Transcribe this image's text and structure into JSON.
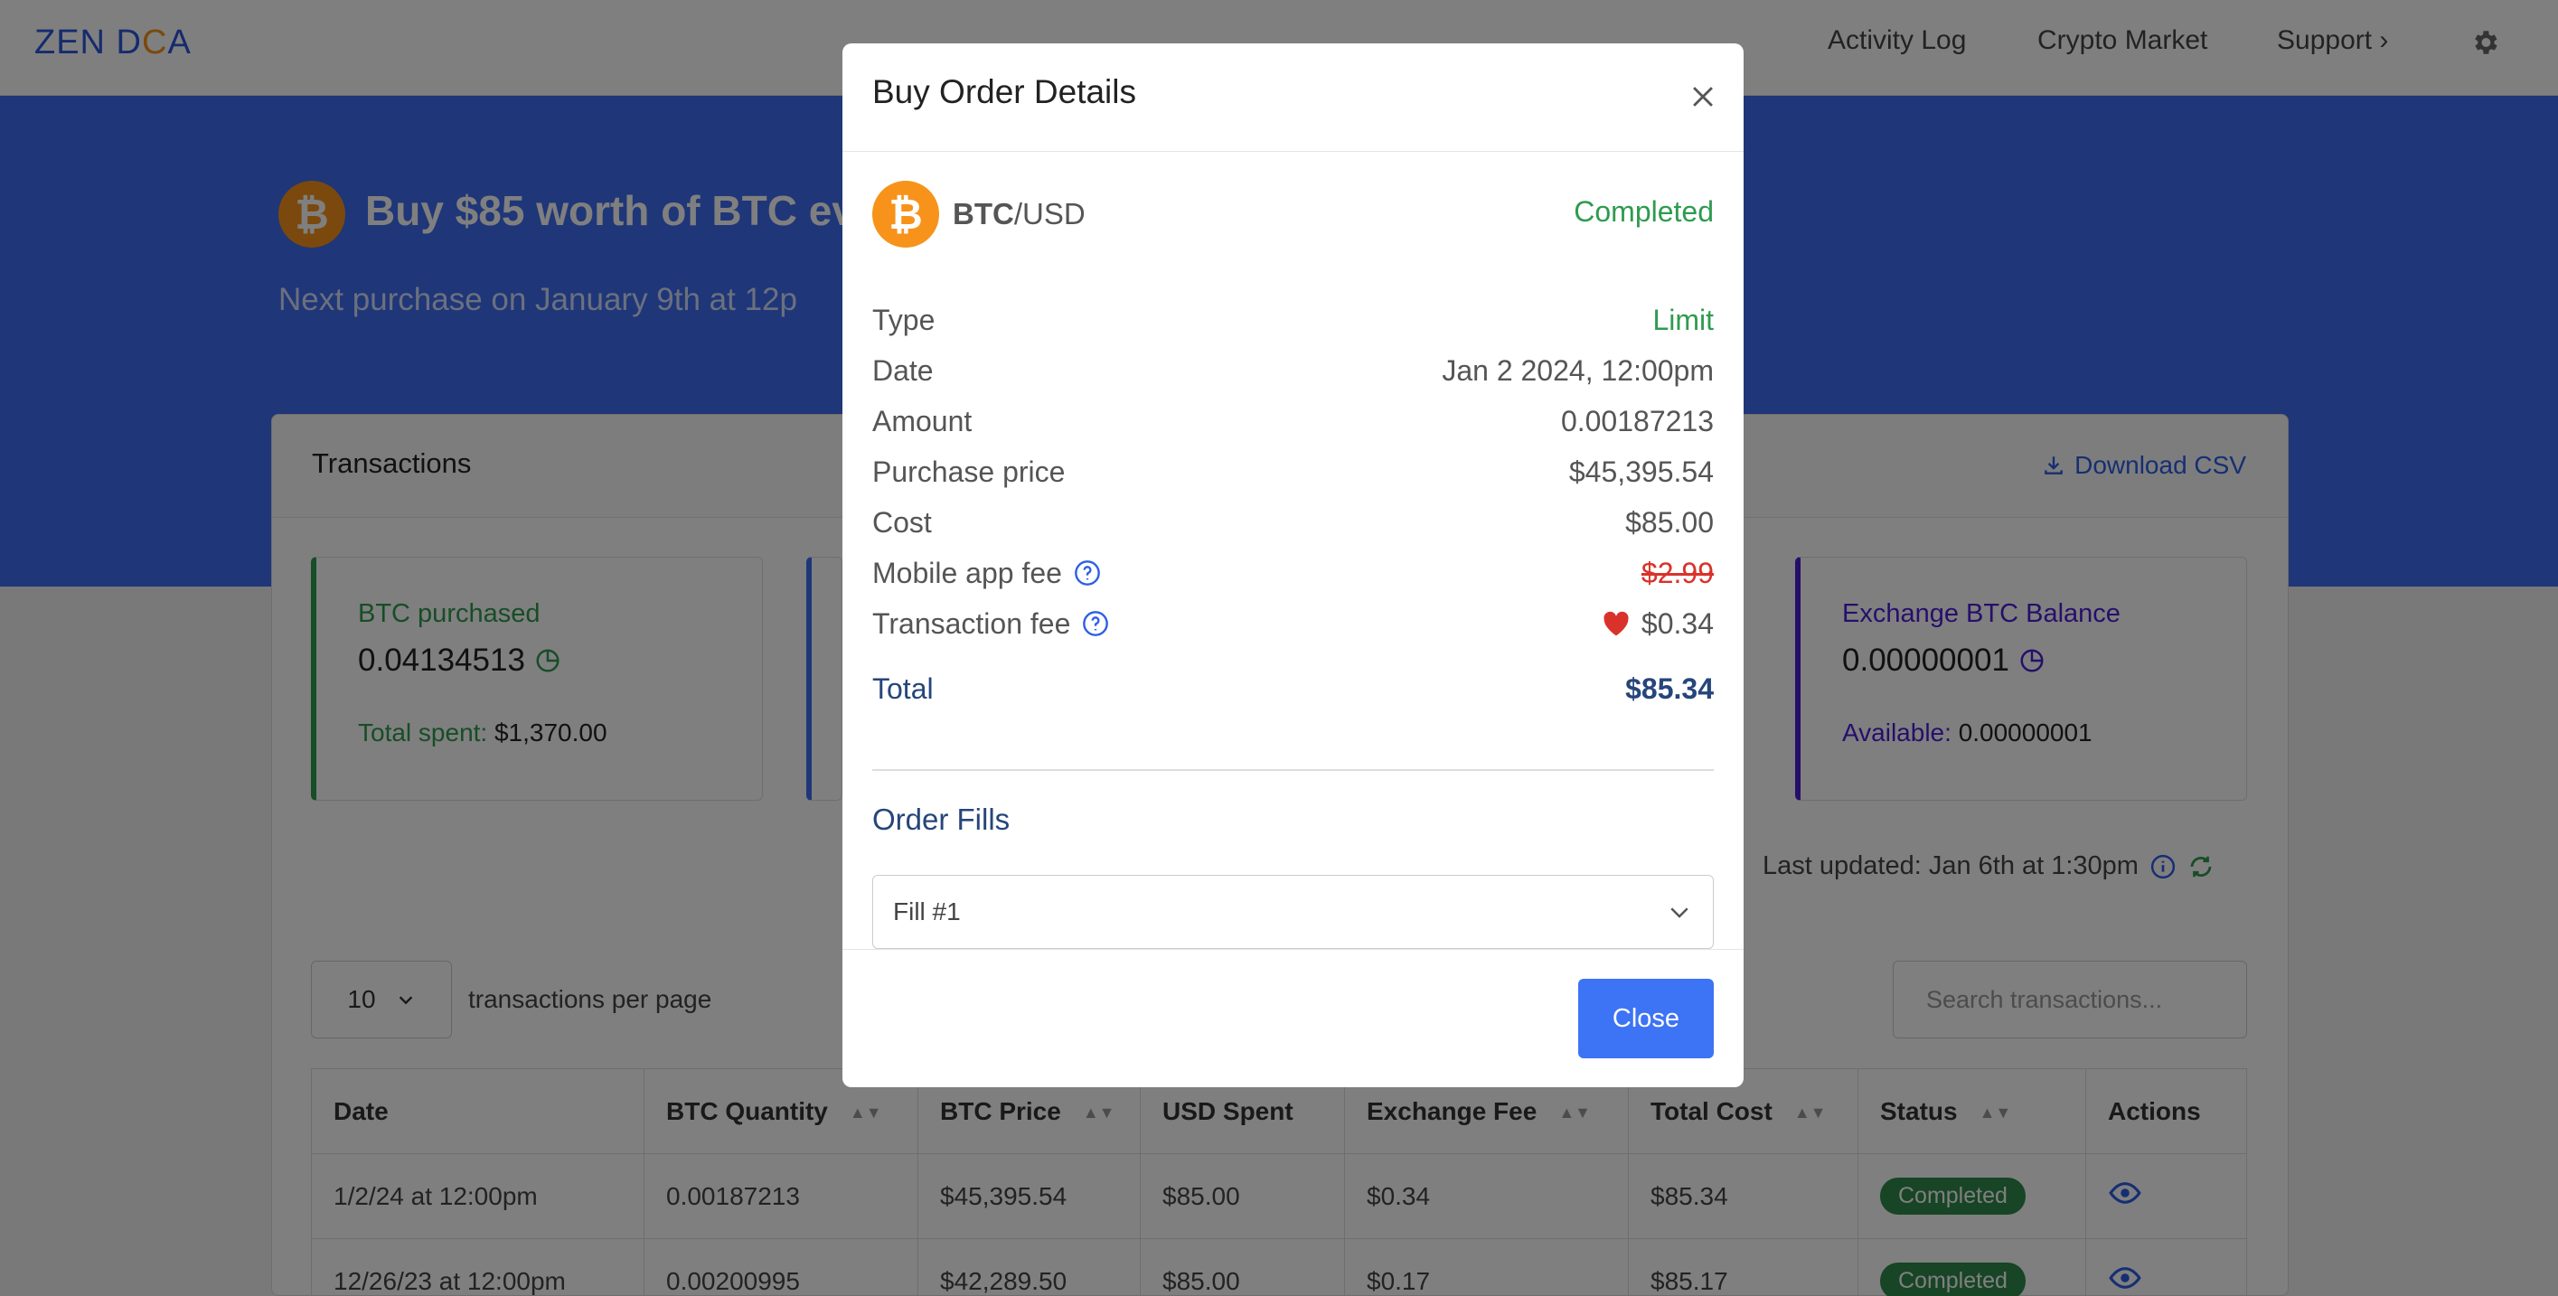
{
  "nav": {
    "logo_pre": "ZEN D",
    "logo_o": "C",
    "logo_post": "A",
    "links": [
      "Activity Log",
      "Crypto Market",
      "Support ›"
    ]
  },
  "hero": {
    "coin_symbol": "₿",
    "title": "Buy $85 worth of BTC ev",
    "subtitle": "Next purchase on January 9th at 12p"
  },
  "card": {
    "title": "Transactions",
    "download_label": "Download CSV",
    "stats": [
      {
        "label": "BTC purchased",
        "value": "0.04134513",
        "foot_key": "Total spent:",
        "foot_value": "$1,370.00"
      },
      {
        "label": "Exchange BTC Balance",
        "value": "0.00000001",
        "foot_key": "Available:",
        "foot_value": "0.00000001"
      }
    ],
    "last_updated": "Last updated: Jan 6th at 1:30pm",
    "per_page_value": "10",
    "per_page_text": "transactions per page",
    "search_placeholder": "Search transactions...",
    "columns": [
      "Date",
      "BTC Quantity",
      "BTC Price",
      "USD Spent",
      "Exchange Fee",
      "Total Cost",
      "Status",
      "Actions"
    ],
    "rows": [
      [
        "1/2/24 at 12:00pm",
        "0.00187213",
        "$45,395.54",
        "$85.00",
        "$0.34",
        "$85.34",
        "Completed"
      ],
      [
        "12/26/23 at 12:00pm",
        "0.00200995",
        "$42,289.50",
        "$85.00",
        "$0.17",
        "$85.17",
        "Completed"
      ]
    ]
  },
  "modal": {
    "title": "Buy Order Details",
    "coin_symbol": "₿",
    "pair_base": "BTC",
    "pair_quote": "/USD",
    "status": "Completed",
    "rows": [
      {
        "label": "Type",
        "value": "Limit"
      },
      {
        "label": "Date",
        "value": "Jan 2 2024, 12:00pm"
      },
      {
        "label": "Amount",
        "value": "0.00187213"
      },
      {
        "label": "Purchase price",
        "value": "$45,395.54"
      },
      {
        "label": "Cost",
        "value": "$85.00"
      },
      {
        "label": "Mobile app fee",
        "value": "$2.99"
      },
      {
        "label": "Transaction fee",
        "value": "$0.34"
      },
      {
        "label": "Total",
        "value": "$85.34"
      }
    ],
    "fills_title": "Order Fills",
    "fill_selected": "Fill #1",
    "close_label": "Close"
  },
  "colors": {
    "brand_blue": "#3e6cf0",
    "bitcoin_orange": "#f7931a",
    "success_green": "#2e9b4f",
    "strike_red": "#d9322a"
  }
}
